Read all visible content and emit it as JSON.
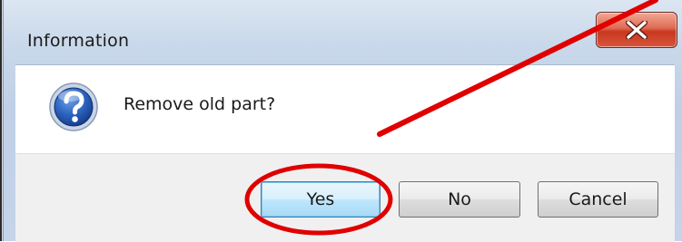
{
  "dialog": {
    "title": "Information",
    "close_icon": "close-icon",
    "icon": "question-icon",
    "message": "Remove old part?"
  },
  "buttons": {
    "yes_label": "Yes",
    "no_label": "No",
    "cancel_label": "Cancel"
  },
  "annotation": {
    "color": "#e00000",
    "shapes": [
      "arrow-line",
      "highlight-ellipse"
    ]
  }
}
